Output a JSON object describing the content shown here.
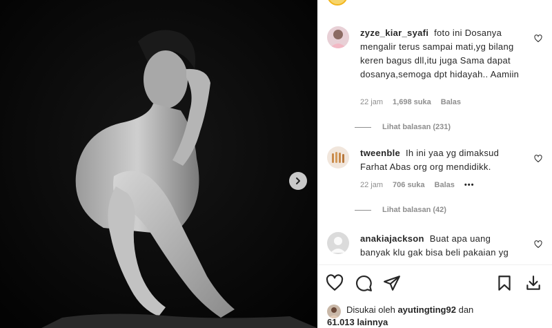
{
  "post": {
    "photo_alt": "black and white studio portrait",
    "next_icon": "chevron-right-icon"
  },
  "comments": [
    {
      "username": "zyze_kiar_syafi",
      "text": "foto ini Dosanya mengalir terus sampai mati,yg bilang keren bagus dll,itu juga Sama dapat dosanya,semoga dpt hidayah.. Aamiin",
      "time": "22 jam",
      "likes": "1,698 suka",
      "reply_label": "Balas",
      "view_replies": "Lihat balasan (231)"
    },
    {
      "username": "tweenble",
      "text": "Ih ini yaa yg dimaksud Farhat Abas org org mendidikk.",
      "time": "22 jam",
      "likes": "706 suka",
      "reply_label": "Balas",
      "more": "•••",
      "view_replies": "Lihat balasan (42)"
    },
    {
      "username": "anakiajackson",
      "text": "Buat apa uang banyak klu gak bisa beli pakaian yg"
    }
  ],
  "actions": {
    "icons": [
      "heart-icon",
      "comment-icon",
      "share-icon",
      "bookmark-icon",
      "download-icon"
    ]
  },
  "liked_by": {
    "prefix": "Disukai oleh",
    "user": "ayutingting92",
    "middle": "dan",
    "count": "61.013 lainnya"
  }
}
